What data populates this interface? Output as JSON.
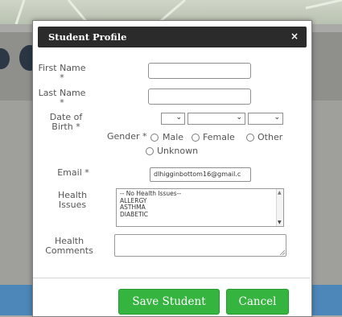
{
  "modal": {
    "title": "Student Profile",
    "close_label": "×"
  },
  "form": {
    "first_name_label": "First Name",
    "last_name_label": "Last Name",
    "required_mark": "*",
    "dob_label_line1": "Date of",
    "dob_label_line2": "Birth *",
    "gender_label": "Gender *",
    "gender_options": [
      "Male",
      "Female",
      "Other",
      "Unknown"
    ],
    "email_label": "Email *",
    "email_value": "dlhigginbottom16@gmail.c",
    "health_issues_label_line1": "Health",
    "health_issues_label_line2": "Issues",
    "health_issues_options": [
      "-- No Health Issues--",
      "ALLERGY",
      "ASTHMA",
      "DIABETIC"
    ],
    "health_comments_label_line1": "Health",
    "health_comments_label_line2": "Comments",
    "dropdown_caret": "⌄"
  },
  "buttons": {
    "save": "Save Student",
    "cancel": "Cancel"
  },
  "colors": {
    "header": "#2b2b2b",
    "button": "#35b43f"
  }
}
